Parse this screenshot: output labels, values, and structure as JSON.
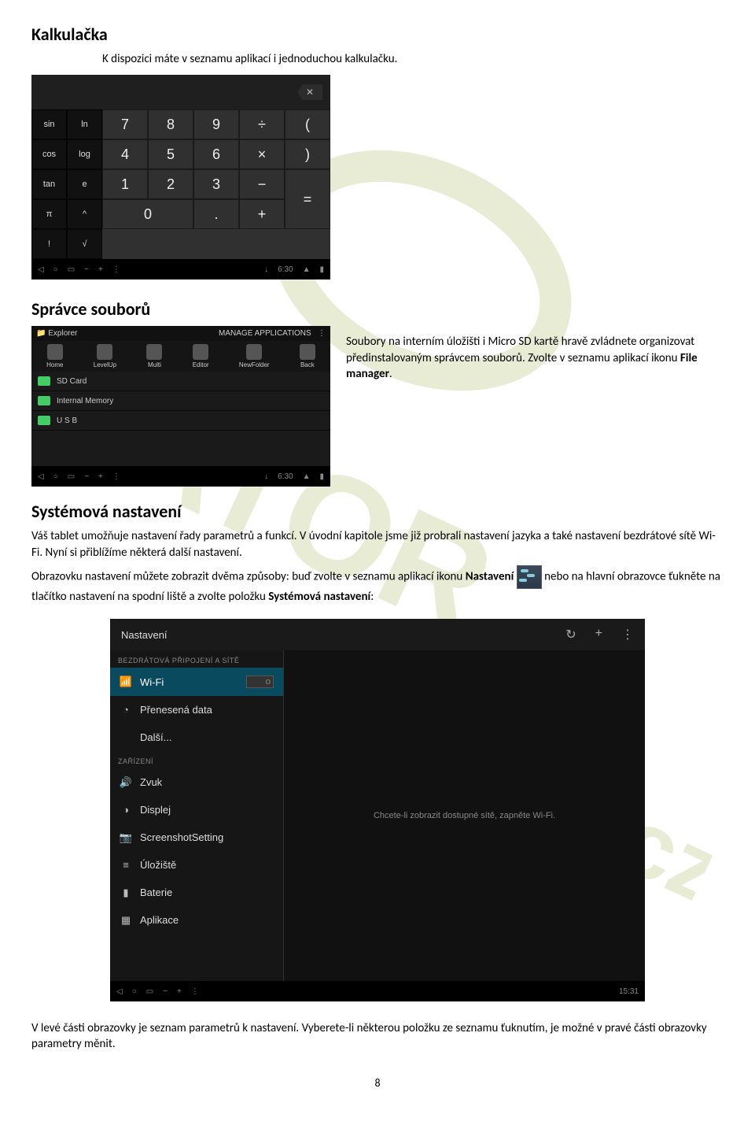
{
  "headings": {
    "kalkulacka": "Kalkulačka",
    "spravce": "Správce souborů",
    "systemova": "Systémová nastavení"
  },
  "text": {
    "calc_intro": "K dispozici máte v seznamu aplikací i jednoduchou kalkulačku.",
    "files_p1": "Soubory na interním úložišti i Micro SD kartě hravě zvládnete organizovat předinstalovaným správcem souborů. Zvolte v seznamu aplikací ikonu ",
    "files_bold": "File manager",
    "files_p1_end": ".",
    "sys_p1": "Váš tablet umožňuje nastavení řady parametrů a funkcí. V úvodní kapitole jsme již probrali nastavení jazyka a také nastavení bezdrátové sítě Wi-Fi. Nyní si přiblížíme některá další nastavení.",
    "sys_p2_a": "Obrazovku nastavení můžete zobrazit dvěma způsoby: buď zvolte v seznamu aplikací ikonu ",
    "sys_p2_bold1": "Nastavení",
    "sys_p2_b": " nebo na hlavní obrazovce ťukněte na tlačítko nastavení na spodní liště a zvolte položku ",
    "sys_p2_bold2": "Systémová nastavení",
    "sys_p2_c": ":",
    "footer_p": "V levé části obrazovky je seznam parametrů k nastavení. Vyberete-li některou položku ze seznamu ťuknutím, je možné v pravé části obrazovky parametry měnit.",
    "page_num": "8"
  },
  "calc": {
    "fn": [
      "sin",
      "ln",
      "cos",
      "log",
      "tan",
      "e",
      "π",
      "^",
      "!",
      "√"
    ],
    "nums_r1": [
      "7",
      "8",
      "9",
      "÷",
      "("
    ],
    "nums_r2": [
      "4",
      "5",
      "6",
      "×",
      ")"
    ],
    "nums_r3": [
      "1",
      "2",
      "3",
      "−",
      "="
    ],
    "nums_r4": [
      "0",
      "0",
      ".",
      "+"
    ],
    "time": "6:30"
  },
  "explorer": {
    "title": "Explorer",
    "manage": "MANAGE APPLICATIONS",
    "tools": [
      "Home",
      "LevelUp",
      "Multi",
      "Editor",
      "NewFolder",
      "Back"
    ],
    "items": [
      "SD Card",
      "Internal Memory",
      "U S B"
    ],
    "time": "6:30"
  },
  "settings": {
    "title": "Nastavení",
    "section_wireless": "BEZDRÁTOVÁ PŘIPOJENÍ A SÍTĚ",
    "wifi": "Wi-Fi",
    "toggle_off": "O",
    "prenesena": "Přenesená data",
    "dalsi": "Další...",
    "section_device": "ZAŘÍZENÍ",
    "zvuk": "Zvuk",
    "displej": "Displej",
    "screenshot": "ScreenshotSetting",
    "uloziste": "Úložiště",
    "baterie": "Baterie",
    "aplikace": "Aplikace",
    "right_hint": "Chcete-li zobrazit dostupné sítě, zapněte Wi-Fi.",
    "time": "15:31"
  },
  "watermark": "igator.cz"
}
